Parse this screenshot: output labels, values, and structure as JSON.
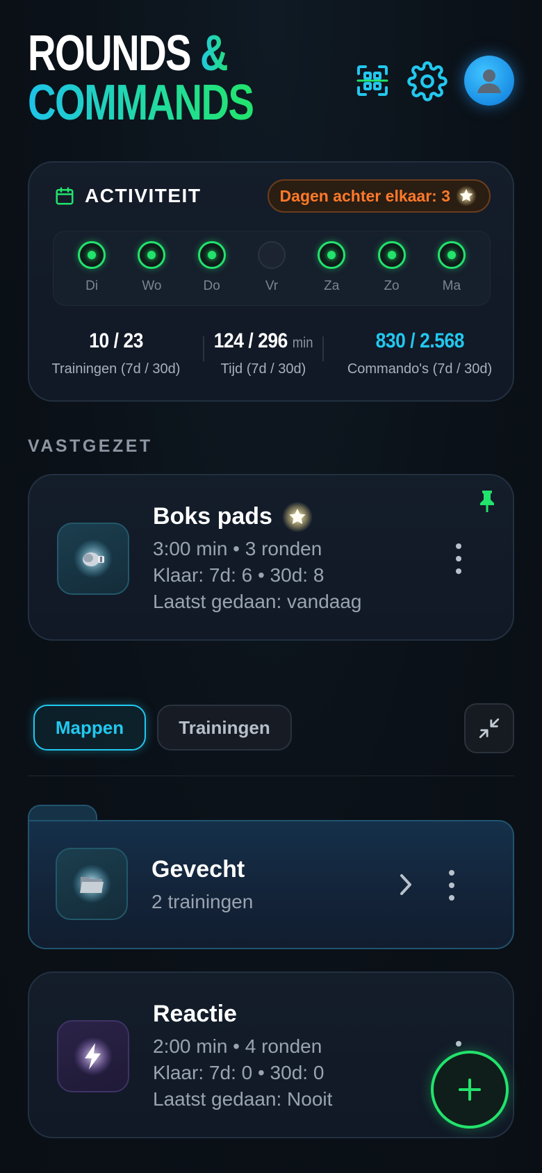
{
  "header": {
    "logo_line1_a": "ROUNDS ",
    "logo_line1_b": "&",
    "logo_line2": "COMMANDS",
    "icons": [
      "scan-icon",
      "gear-icon",
      "user-icon"
    ]
  },
  "activity": {
    "title": "ACTIVITEIT",
    "streak": "Dagen achter elkaar: 3",
    "days": [
      {
        "label": "Di",
        "done": true
      },
      {
        "label": "Wo",
        "done": true
      },
      {
        "label": "Do",
        "done": true
      },
      {
        "label": "Vr",
        "done": false
      },
      {
        "label": "Za",
        "done": true
      },
      {
        "label": "Zo",
        "done": true
      },
      {
        "label": "Ma",
        "done": true
      }
    ],
    "stats": [
      {
        "value": "10 / 23",
        "unit": "",
        "label": "Trainingen (7d / 30d)"
      },
      {
        "value": "124 / 296",
        "unit": "min",
        "label": "Tijd (7d / 30d)"
      },
      {
        "value": "830 / 2.568",
        "unit": "",
        "label": "Commando's (7d / 30d)"
      }
    ]
  },
  "pinned": {
    "section_label": "VASTGEZET",
    "name": "Boks pads",
    "line1": "3:00 min • 3 ronden",
    "line2": "Klaar: 7d: 6 • 30d: 8",
    "line3": "Laatst gedaan: vandaag"
  },
  "tabs": {
    "active": "Mappen",
    "inactive": "Trainingen"
  },
  "folder": {
    "name": "Gevecht",
    "count": "2 trainingen"
  },
  "training2": {
    "name": "Reactie",
    "line1": "2:00 min • 4 ronden",
    "line2": "Klaar: 7d: 0 • 30d: 0",
    "line3": "Laatst gedaan: Nooit"
  },
  "fab": {
    "label": "+"
  },
  "colors": {
    "accent_green": "#22e36c",
    "accent_cyan": "#22c8ef",
    "streak_orange": "#ff7a2a"
  }
}
